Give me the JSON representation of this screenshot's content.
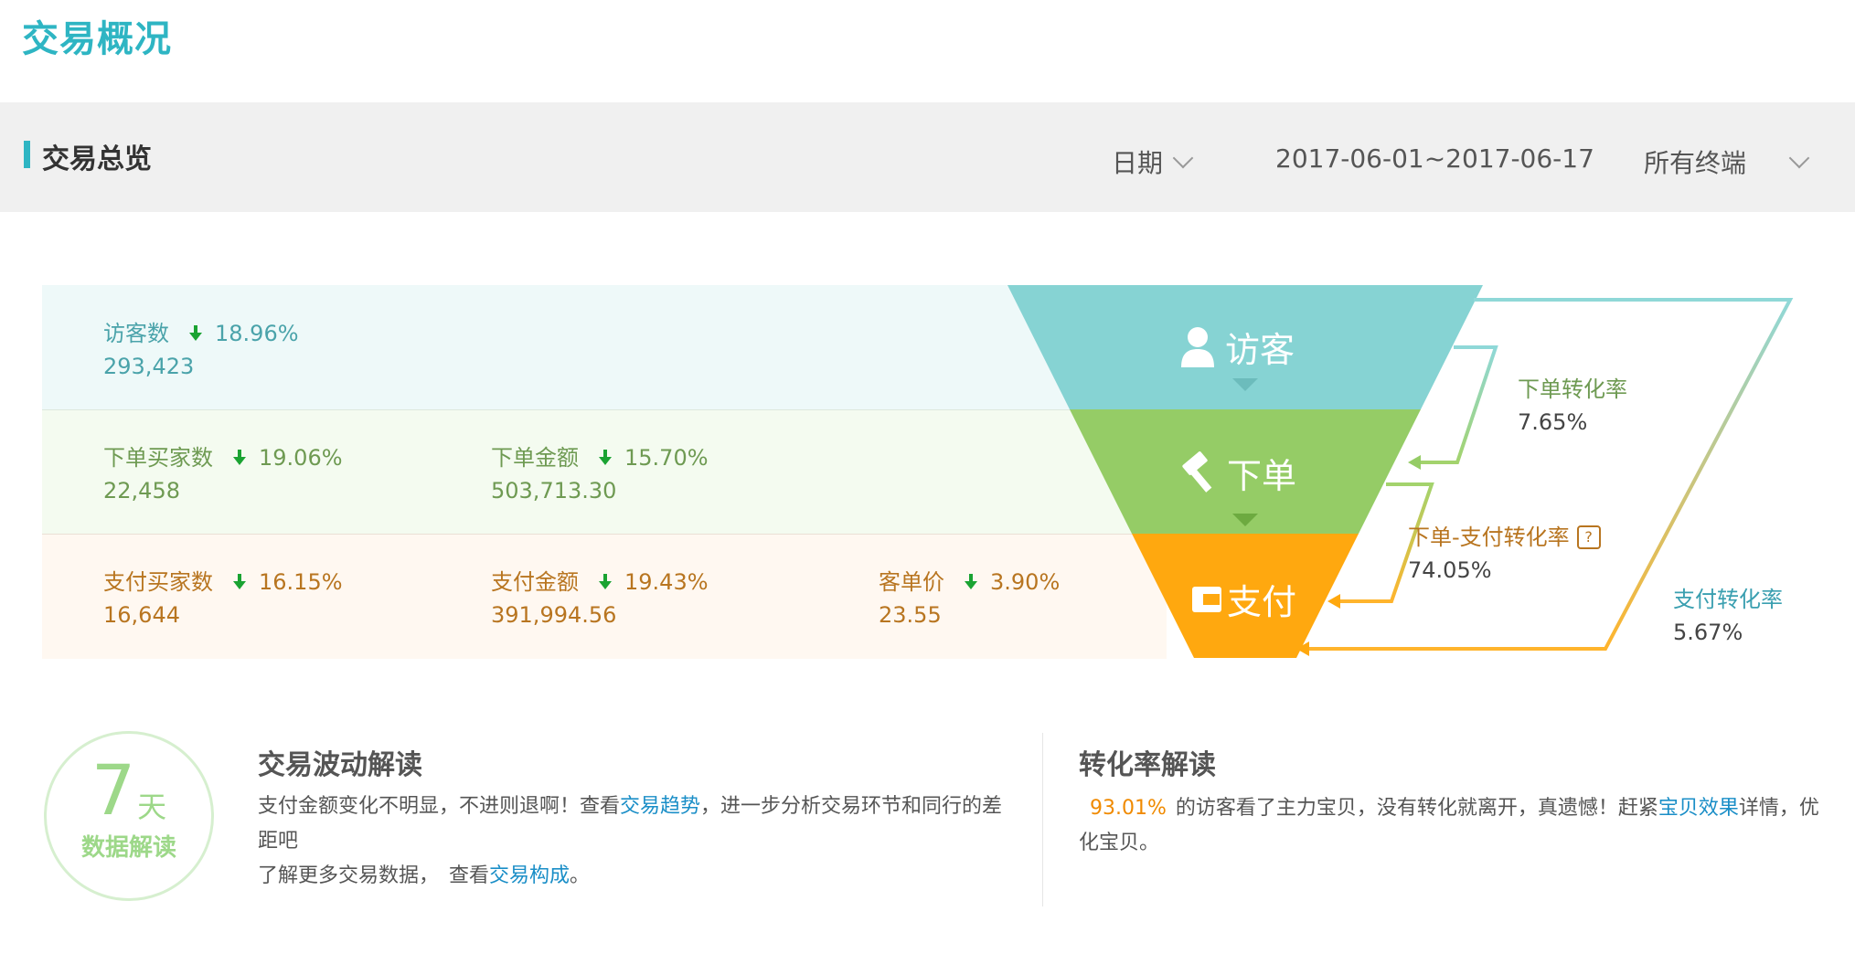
{
  "header": {
    "title": "交易概况"
  },
  "section": {
    "title": "交易总览",
    "filters": {
      "date_label": "日期",
      "date_range": "2017-06-01~2017-06-17",
      "terminal": "所有终端"
    }
  },
  "colors": {
    "accent": "#2eb5c3",
    "visitor": "#86d3d3",
    "order": "#95cc66",
    "pay": "#ffa80f",
    "down_arrow": "#1aa332"
  },
  "metrics": {
    "visitors": {
      "label": "访客数",
      "change": "18.96%",
      "value": "293,423",
      "trend": "down"
    },
    "order_buyers": {
      "label": "下单买家数",
      "change": "19.06%",
      "value": "22,458",
      "trend": "down"
    },
    "order_amount": {
      "label": "下单金额",
      "change": "15.70%",
      "value": "503,713.30",
      "trend": "down"
    },
    "pay_buyers": {
      "label": "支付买家数",
      "change": "16.15%",
      "value": "16,644",
      "trend": "down"
    },
    "pay_amount": {
      "label": "支付金额",
      "change": "19.43%",
      "value": "391,994.56",
      "trend": "down"
    },
    "unit_price": {
      "label": "客单价",
      "change": "3.90%",
      "value": "23.55",
      "trend": "down"
    }
  },
  "funnel": {
    "stages": [
      {
        "label": "访客",
        "icon": "user-icon"
      },
      {
        "label": "下单",
        "icon": "hammer-icon"
      },
      {
        "label": "支付",
        "icon": "wallet-icon"
      }
    ],
    "conversions": {
      "order_rate": {
        "label": "下单转化率",
        "value": "7.65%"
      },
      "order_pay_rate": {
        "label": "下单-支付转化率",
        "value": "74.05%"
      },
      "pay_rate": {
        "label": "支付转化率",
        "value": "5.67%"
      }
    }
  },
  "badge": {
    "number": "7",
    "unit": "天",
    "caption": "数据解读"
  },
  "fluctuation": {
    "title": "交易波动解读",
    "text_part1": "支付金额变化不明显，不进则退啊！查看",
    "link1": "交易趋势",
    "text_part2": "，进一步分析交易环节和同行的差距吧",
    "text_part3": "了解更多交易数据，　查看",
    "link2": "交易构成",
    "text_part4": "。"
  },
  "conversion_interp": {
    "title": "转化率解读",
    "highlight": "93.01%",
    "text_part1": "的访客看了主力宝贝，没有转化就离开，真遗憾！赶紧",
    "link": "宝贝效果",
    "text_part2": "详情，优化宝贝。"
  }
}
